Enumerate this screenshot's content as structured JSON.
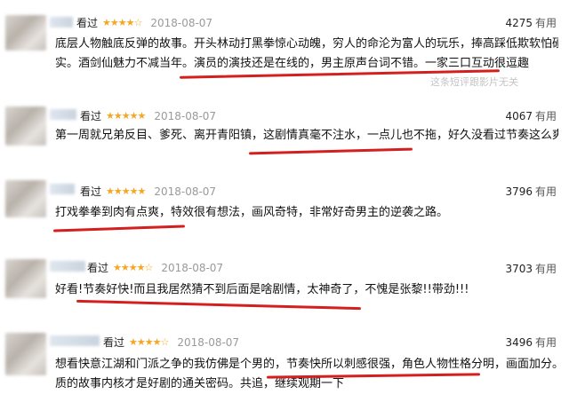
{
  "reviews": [
    {
      "seen": "看过",
      "stars": "★★★★☆",
      "date": "2018-08-07",
      "useful": "4275",
      "useful_icon": "有用",
      "lines": [
        "底层人物触底反弹的故事。开头林动打黑拳惊心动魄，穷人的命沦为富人的玩乐，捧高踩低欺软怕硬很现",
        "实。酒剑仙魅力不减当年。演员的演技还是在线的，男主原声台词不错。一家三口互动很逗趣"
      ]
    },
    {
      "seen": "看过",
      "name_tail": "风",
      "stars": "★★★★★",
      "date": "2018-08-07",
      "useful": "4067",
      "useful_icon": "有用",
      "lines": [
        "第一周就兄弟反目、爹死、离开青阳镇，这剧情真毫不注水，一点儿也不拖，好久没看过节奏这么爽的剧了"
      ]
    },
    {
      "seen": "看过",
      "stars": "★★★★★",
      "date": "2018-08-07",
      "useful": "3796",
      "useful_icon": "有用",
      "lines": [
        "打戏拳拳到肉有点爽，特效很有想法，画风奇特，非常好奇男主的逆袭之路。"
      ]
    },
    {
      "seen": "看过",
      "name_tail": "张",
      "stars": "★★★★☆",
      "date": "2018-08-07",
      "useful": "3703",
      "useful_icon": "有用",
      "lines": [
        "好看!节奏好快!而且我居然猜不到后面是啥剧情，太神奇了，不愧是张黎!!带劲!!!"
      ]
    },
    {
      "seen": "看过",
      "name_tail": "说",
      "stars": "★★★★☆",
      "date": "2018-08-07",
      "useful": "3496",
      "useful_icon": "有用",
      "lines": [
        "想看快意江湖和门派之争的我仿佛是个男的，节奏快所以刺感很强，角色人物性格分明，画面加分。不过优",
        "质的故事内核才是好剧的通关密码。共追，继续观期一下"
      ]
    }
  ],
  "watermark": "这条短评跟影片无关"
}
